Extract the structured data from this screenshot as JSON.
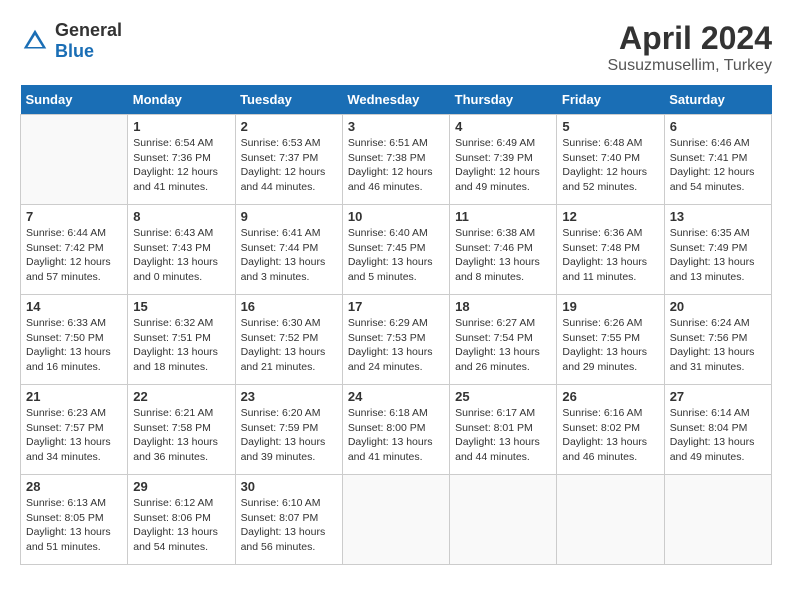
{
  "header": {
    "logo": {
      "general": "General",
      "blue": "Blue"
    },
    "title": "April 2024",
    "location": "Susuzmusellim, Turkey"
  },
  "calendar": {
    "days_of_week": [
      "Sunday",
      "Monday",
      "Tuesday",
      "Wednesday",
      "Thursday",
      "Friday",
      "Saturday"
    ],
    "weeks": [
      [
        {
          "day": "",
          "info": ""
        },
        {
          "day": "1",
          "info": "Sunrise: 6:54 AM\nSunset: 7:36 PM\nDaylight: 12 hours\nand 41 minutes."
        },
        {
          "day": "2",
          "info": "Sunrise: 6:53 AM\nSunset: 7:37 PM\nDaylight: 12 hours\nand 44 minutes."
        },
        {
          "day": "3",
          "info": "Sunrise: 6:51 AM\nSunset: 7:38 PM\nDaylight: 12 hours\nand 46 minutes."
        },
        {
          "day": "4",
          "info": "Sunrise: 6:49 AM\nSunset: 7:39 PM\nDaylight: 12 hours\nand 49 minutes."
        },
        {
          "day": "5",
          "info": "Sunrise: 6:48 AM\nSunset: 7:40 PM\nDaylight: 12 hours\nand 52 minutes."
        },
        {
          "day": "6",
          "info": "Sunrise: 6:46 AM\nSunset: 7:41 PM\nDaylight: 12 hours\nand 54 minutes."
        }
      ],
      [
        {
          "day": "7",
          "info": "Sunrise: 6:44 AM\nSunset: 7:42 PM\nDaylight: 12 hours\nand 57 minutes."
        },
        {
          "day": "8",
          "info": "Sunrise: 6:43 AM\nSunset: 7:43 PM\nDaylight: 13 hours\nand 0 minutes."
        },
        {
          "day": "9",
          "info": "Sunrise: 6:41 AM\nSunset: 7:44 PM\nDaylight: 13 hours\nand 3 minutes."
        },
        {
          "day": "10",
          "info": "Sunrise: 6:40 AM\nSunset: 7:45 PM\nDaylight: 13 hours\nand 5 minutes."
        },
        {
          "day": "11",
          "info": "Sunrise: 6:38 AM\nSunset: 7:46 PM\nDaylight: 13 hours\nand 8 minutes."
        },
        {
          "day": "12",
          "info": "Sunrise: 6:36 AM\nSunset: 7:48 PM\nDaylight: 13 hours\nand 11 minutes."
        },
        {
          "day": "13",
          "info": "Sunrise: 6:35 AM\nSunset: 7:49 PM\nDaylight: 13 hours\nand 13 minutes."
        }
      ],
      [
        {
          "day": "14",
          "info": "Sunrise: 6:33 AM\nSunset: 7:50 PM\nDaylight: 13 hours\nand 16 minutes."
        },
        {
          "day": "15",
          "info": "Sunrise: 6:32 AM\nSunset: 7:51 PM\nDaylight: 13 hours\nand 18 minutes."
        },
        {
          "day": "16",
          "info": "Sunrise: 6:30 AM\nSunset: 7:52 PM\nDaylight: 13 hours\nand 21 minutes."
        },
        {
          "day": "17",
          "info": "Sunrise: 6:29 AM\nSunset: 7:53 PM\nDaylight: 13 hours\nand 24 minutes."
        },
        {
          "day": "18",
          "info": "Sunrise: 6:27 AM\nSunset: 7:54 PM\nDaylight: 13 hours\nand 26 minutes."
        },
        {
          "day": "19",
          "info": "Sunrise: 6:26 AM\nSunset: 7:55 PM\nDaylight: 13 hours\nand 29 minutes."
        },
        {
          "day": "20",
          "info": "Sunrise: 6:24 AM\nSunset: 7:56 PM\nDaylight: 13 hours\nand 31 minutes."
        }
      ],
      [
        {
          "day": "21",
          "info": "Sunrise: 6:23 AM\nSunset: 7:57 PM\nDaylight: 13 hours\nand 34 minutes."
        },
        {
          "day": "22",
          "info": "Sunrise: 6:21 AM\nSunset: 7:58 PM\nDaylight: 13 hours\nand 36 minutes."
        },
        {
          "day": "23",
          "info": "Sunrise: 6:20 AM\nSunset: 7:59 PM\nDaylight: 13 hours\nand 39 minutes."
        },
        {
          "day": "24",
          "info": "Sunrise: 6:18 AM\nSunset: 8:00 PM\nDaylight: 13 hours\nand 41 minutes."
        },
        {
          "day": "25",
          "info": "Sunrise: 6:17 AM\nSunset: 8:01 PM\nDaylight: 13 hours\nand 44 minutes."
        },
        {
          "day": "26",
          "info": "Sunrise: 6:16 AM\nSunset: 8:02 PM\nDaylight: 13 hours\nand 46 minutes."
        },
        {
          "day": "27",
          "info": "Sunrise: 6:14 AM\nSunset: 8:04 PM\nDaylight: 13 hours\nand 49 minutes."
        }
      ],
      [
        {
          "day": "28",
          "info": "Sunrise: 6:13 AM\nSunset: 8:05 PM\nDaylight: 13 hours\nand 51 minutes."
        },
        {
          "day": "29",
          "info": "Sunrise: 6:12 AM\nSunset: 8:06 PM\nDaylight: 13 hours\nand 54 minutes."
        },
        {
          "day": "30",
          "info": "Sunrise: 6:10 AM\nSunset: 8:07 PM\nDaylight: 13 hours\nand 56 minutes."
        },
        {
          "day": "",
          "info": ""
        },
        {
          "day": "",
          "info": ""
        },
        {
          "day": "",
          "info": ""
        },
        {
          "day": "",
          "info": ""
        }
      ]
    ]
  }
}
